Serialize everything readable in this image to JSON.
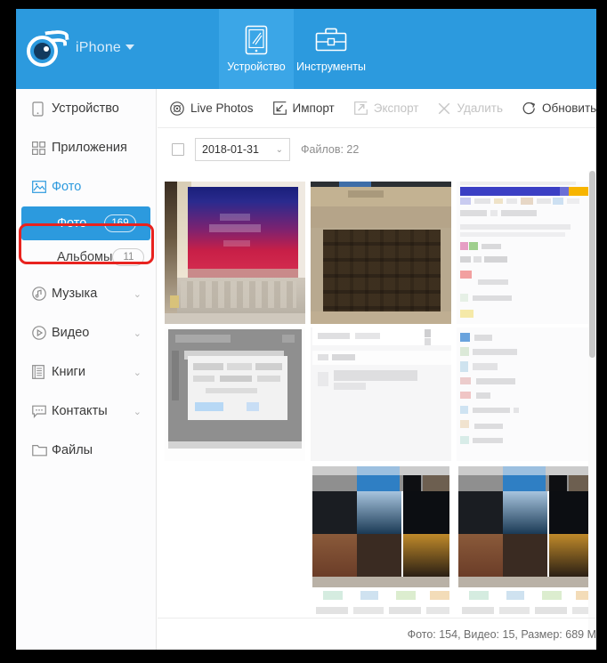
{
  "header": {
    "logo_icon": "itools-eye-logo",
    "device_label": "iPhone",
    "dropdown_icon": "caret-down-icon",
    "tabs": [
      {
        "label": "Устройство",
        "icon": "device-phone-icon",
        "active": true
      },
      {
        "label": "Инструменты",
        "icon": "toolbox-briefcase-icon",
        "active": false
      }
    ],
    "accent_color": "#2c9ade",
    "active_tab_color": "#3ba6e7"
  },
  "sidebar": {
    "items": [
      {
        "label": "Устройство",
        "icon": "phone-icon",
        "chevron": false,
        "selected": false
      },
      {
        "label": "Приложения",
        "icon": "grid-apps-icon",
        "chevron": false,
        "selected": false
      },
      {
        "label": "Фото",
        "icon": "photo-image-icon",
        "chevron": false,
        "selected": true
      },
      {
        "label": "Музыка",
        "icon": "music-note-circle-icon",
        "chevron": true,
        "selected": false
      },
      {
        "label": "Видео",
        "icon": "video-play-circle-icon",
        "chevron": true,
        "selected": false
      },
      {
        "label": "Книги",
        "icon": "book-icon",
        "chevron": true,
        "selected": false
      },
      {
        "label": "Контакты",
        "icon": "contacts-chat-icon",
        "chevron": true,
        "selected": false
      },
      {
        "label": "Файлы",
        "icon": "folder-icon",
        "chevron": false,
        "selected": false
      }
    ],
    "sub_items": [
      {
        "label": "Фото",
        "count": "169",
        "active": true
      },
      {
        "label": "Альбомы",
        "count": "11",
        "active": false
      }
    ],
    "highlight_color": "#e8231f"
  },
  "toolbar": {
    "buttons": [
      {
        "label": "Live Photos",
        "icon": "live-photos-icon",
        "disabled": false
      },
      {
        "label": "Импорт",
        "icon": "import-arrow-icon",
        "disabled": false
      },
      {
        "label": "Экспорт",
        "icon": "export-arrow-icon",
        "disabled": true
      },
      {
        "label": "Удалить",
        "icon": "delete-cross-icon",
        "disabled": true
      },
      {
        "label": "Обновить",
        "icon": "refresh-circle-icon",
        "disabled": false
      }
    ]
  },
  "filterbar": {
    "select_all_checkbox": "select-all-checkbox",
    "date_value": "2018-01-31",
    "date_chevron_icon": "chevron-down-icon",
    "file_count_label": "Файлов: 22"
  },
  "grid": {
    "thumbnails": [
      {
        "position": "row1-col1",
        "description": "laptop-screen-pink-blue-photo"
      },
      {
        "position": "row1-col2",
        "description": "keyboard-closeup-photo"
      },
      {
        "position": "row1-col3",
        "description": "browser-page-screenshot"
      },
      {
        "position": "row2-col1",
        "description": "gray-dialog-window-screenshot"
      },
      {
        "position": "row2-col2",
        "description": "white-document-screenshot"
      },
      {
        "position": "row2-col3",
        "description": "browser-page-screenshot-continued"
      },
      {
        "position": "row3-col2",
        "description": "dark-gallery-screenshot"
      },
      {
        "position": "row3-col3",
        "description": "dark-gallery-screenshot"
      }
    ],
    "scrollbar": "vertical-scrollbar"
  },
  "statusbar": {
    "summary": "Фото: 154, Видео: 15, Размер: 689 М"
  }
}
